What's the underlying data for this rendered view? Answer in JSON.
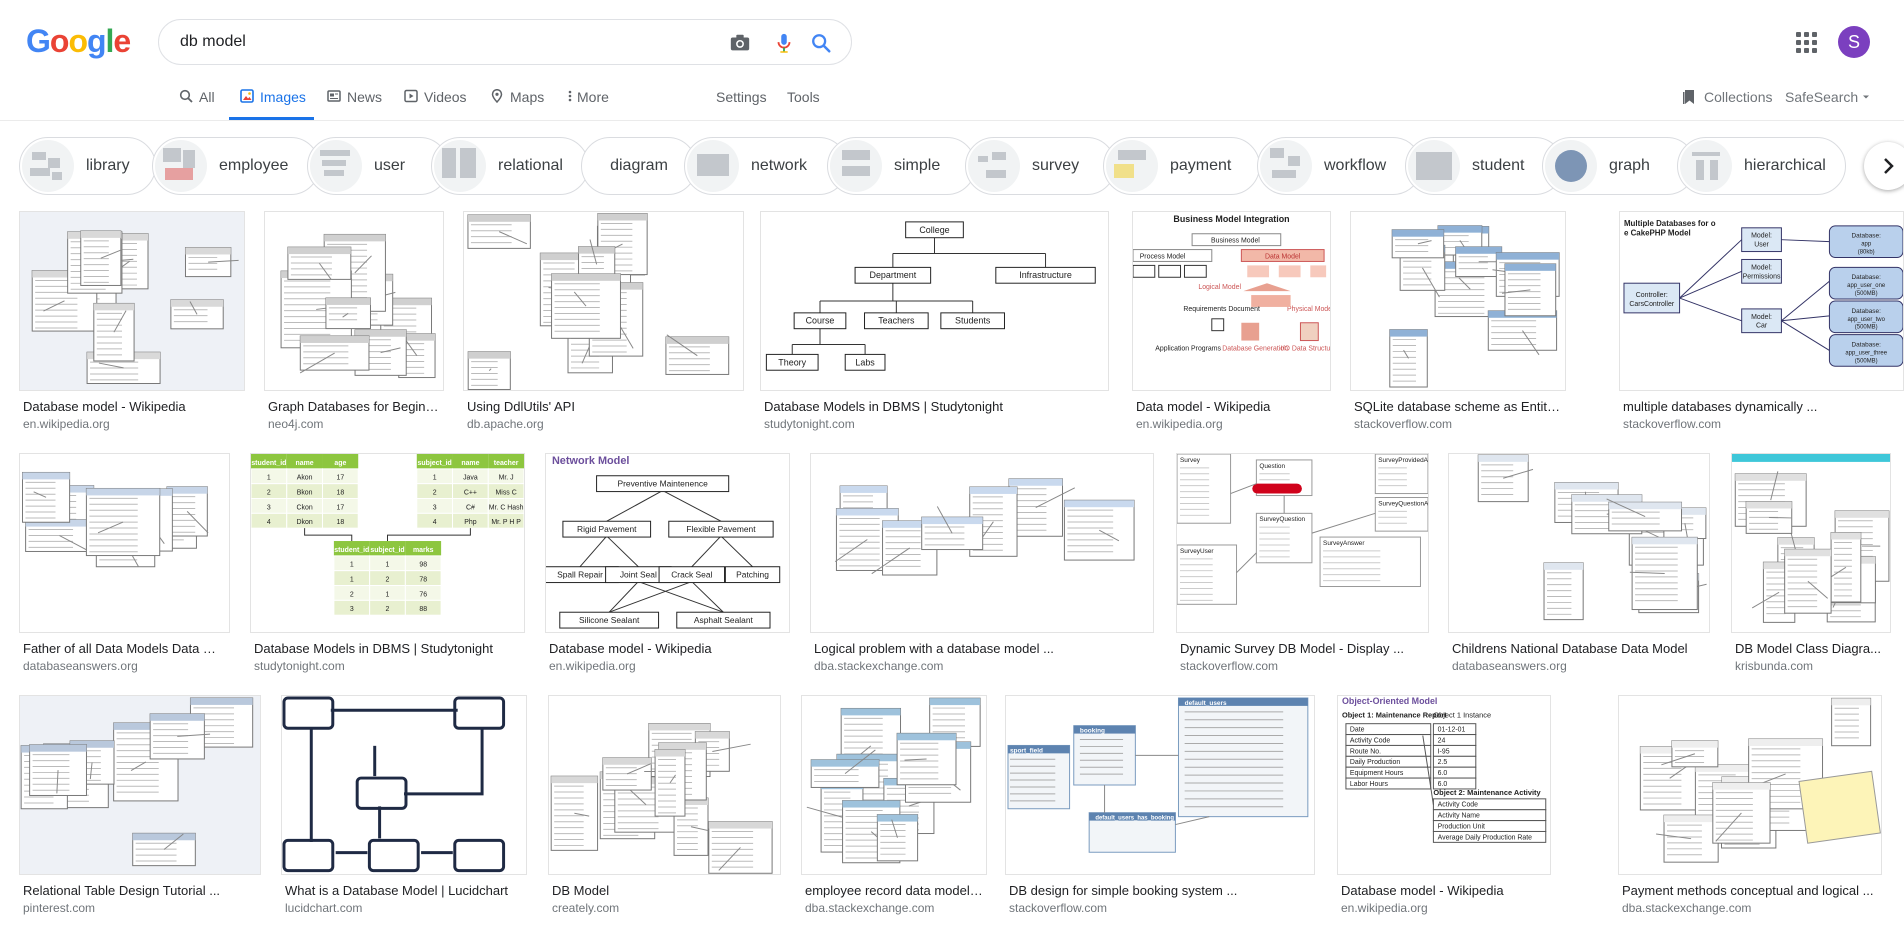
{
  "header": {
    "logo_letters": [
      "G",
      "o",
      "o",
      "g",
      "l",
      "e"
    ],
    "logo_colors": [
      "#4285f4",
      "#ea4335",
      "#fbbc05",
      "#4285f4",
      "#34a853",
      "#ea4335"
    ],
    "query": "db model",
    "avatar_letter": "S"
  },
  "tabs": [
    {
      "label": "All",
      "icon": "search-icon"
    },
    {
      "label": "Images",
      "icon": "image-icon",
      "active": true
    },
    {
      "label": "News",
      "icon": "news-icon"
    },
    {
      "label": "Videos",
      "icon": "video-icon"
    },
    {
      "label": "Maps",
      "icon": "map-pin-icon"
    },
    {
      "label": "More",
      "icon": "more-vert-icon"
    },
    {
      "label": "Settings"
    },
    {
      "label": "Tools"
    }
  ],
  "right_tools": {
    "collections": "Collections",
    "safesearch": "SafeSearch"
  },
  "chips": [
    {
      "label": "library"
    },
    {
      "label": "employee"
    },
    {
      "label": "user"
    },
    {
      "label": "relational"
    },
    {
      "label": "diagram"
    },
    {
      "label": "network"
    },
    {
      "label": "simple"
    },
    {
      "label": "survey"
    },
    {
      "label": "payment"
    },
    {
      "label": "workflow"
    },
    {
      "label": "student"
    },
    {
      "label": "graph"
    },
    {
      "label": "hierarchical"
    }
  ],
  "results": [
    [
      {
        "title": "Database model - Wikipedia",
        "site": "en.wikipedia.org"
      },
      {
        "title": "Graph Databases for Beginne...",
        "site": "neo4j.com"
      },
      {
        "title": "Using DdlUtils' API",
        "site": "db.apache.org"
      },
      {
        "title": "Database Models in DBMS | Studytonight",
        "site": "studytonight.com"
      },
      {
        "title": "Data model - Wikipedia",
        "site": "en.wikipedia.org"
      },
      {
        "title": "SQLite database scheme as Entity ...",
        "site": "stackoverflow.com"
      },
      {
        "title": "multiple databases dynamically ...",
        "site": "stackoverflow.com"
      }
    ],
    [
      {
        "title": "Father of all Data Models Data Mo...",
        "site": "databaseanswers.org"
      },
      {
        "title": "Database Models in DBMS | Studytonight",
        "site": "studytonight.com"
      },
      {
        "title": "Database model - Wikipedia",
        "site": "en.wikipedia.org"
      },
      {
        "title": "Logical problem with a database model ...",
        "site": "dba.stackexchange.com"
      },
      {
        "title": "Dynamic Survey DB Model - Display ...",
        "site": "stackoverflow.com"
      },
      {
        "title": "Childrens National Database Data Model",
        "site": "databaseanswers.org"
      },
      {
        "title": "DB Model Class Diagra...",
        "site": "krisbunda.com"
      }
    ],
    [
      {
        "title": "Relational Table Design Tutorial ...",
        "site": "pinterest.com"
      },
      {
        "title": "What is a Database Model | Lucidchart",
        "site": "lucidchart.com"
      },
      {
        "title": "DB Model",
        "site": "creately.com"
      },
      {
        "title": "employee record data model - ...",
        "site": "dba.stackexchange.com"
      },
      {
        "title": "DB design for simple booking system ...",
        "site": "stackoverflow.com"
      },
      {
        "title": "Database model - Wikipedia",
        "site": "en.wikipedia.org"
      },
      {
        "title": "Payment methods conceptual and logical ...",
        "site": "dba.stackexchange.com"
      }
    ]
  ],
  "image_text": {
    "college_tree": [
      "College",
      "Department",
      "Infrastructure",
      "Course",
      "Teachers",
      "Students",
      "Theory",
      "Labs"
    ],
    "network_model": [
      "Network Model",
      "Preventive Maintenence",
      "Rigid Pavement",
      "Flexible Pavement",
      "Spall Repair",
      "Joint Seal",
      "Crack Seal",
      "Patching",
      "Silicone Sealant",
      "Asphalt Sealant"
    ],
    "business_model": [
      "Business Model Integration",
      "Business Model",
      "Process Model",
      "Data Model",
      "Logical Model",
      "Physical Model",
      "Requirements Document",
      "Application Programs",
      "Database Generation",
      "I/O Data Structures"
    ],
    "multi_db": [
      "Multiple Databases for one CakePHP Model",
      "Model: User",
      "Model: Permissions",
      "Model: Car",
      "Controller: CarsController",
      "Database: app (80kb)",
      "Database: app_user_one (500MB)",
      "Database: app_user_two (500MB)",
      "Database: app_user_three (500MB)"
    ],
    "student_tables": {
      "t1_header": [
        "student_id",
        "name",
        "age"
      ],
      "t1_rows": [
        [
          "1",
          "Akon",
          "17"
        ],
        [
          "2",
          "Bkon",
          "18"
        ],
        [
          "3",
          "Ckon",
          "17"
        ],
        [
          "4",
          "Dkon",
          "18"
        ]
      ],
      "t2_header": [
        "subject_id",
        "name",
        "teacher"
      ],
      "t2_rows": [
        [
          "1",
          "Java",
          "Mr. J"
        ],
        [
          "2",
          "C++",
          "Miss C"
        ],
        [
          "3",
          "C#",
          "Mr. C Hash"
        ],
        [
          "4",
          "Php",
          "Mr. P H P"
        ]
      ],
      "t3_header": [
        "student_id",
        "subject_id",
        "marks"
      ],
      "t3_rows": [
        [
          "1",
          "1",
          "98"
        ],
        [
          "1",
          "2",
          "78"
        ],
        [
          "2",
          "1",
          "76"
        ],
        [
          "3",
          "2",
          "88"
        ]
      ]
    },
    "oo_model": {
      "title": "Object-Oriented Model",
      "obj1": "Object 1: Maintenance Report",
      "obj1_instance": "Object 1 Instance",
      "fields": [
        "Date",
        "Activity Code",
        "Route No.",
        "Daily Production",
        "Equipment Hours",
        "Labor Hours"
      ],
      "values": [
        "01-12-01",
        "24",
        "I-95",
        "2.5",
        "6.0",
        "6.0"
      ],
      "obj2": "Object 2: Maintenance Activity",
      "obj2_fields": [
        "Activity Code",
        "Activity Name",
        "Production Unit",
        "Average Daily Production Rate"
      ]
    },
    "survey_labels": [
      "Survey",
      "Question",
      "SurveyQuestion",
      "SurveyProvidedAnswers",
      "SurveyQuestionAnswer",
      "SurveyAnswer",
      "SurveyUser"
    ],
    "booking_labels": [
      "booking",
      "sport_field",
      "default_users",
      "default_users_has_booking"
    ]
  }
}
